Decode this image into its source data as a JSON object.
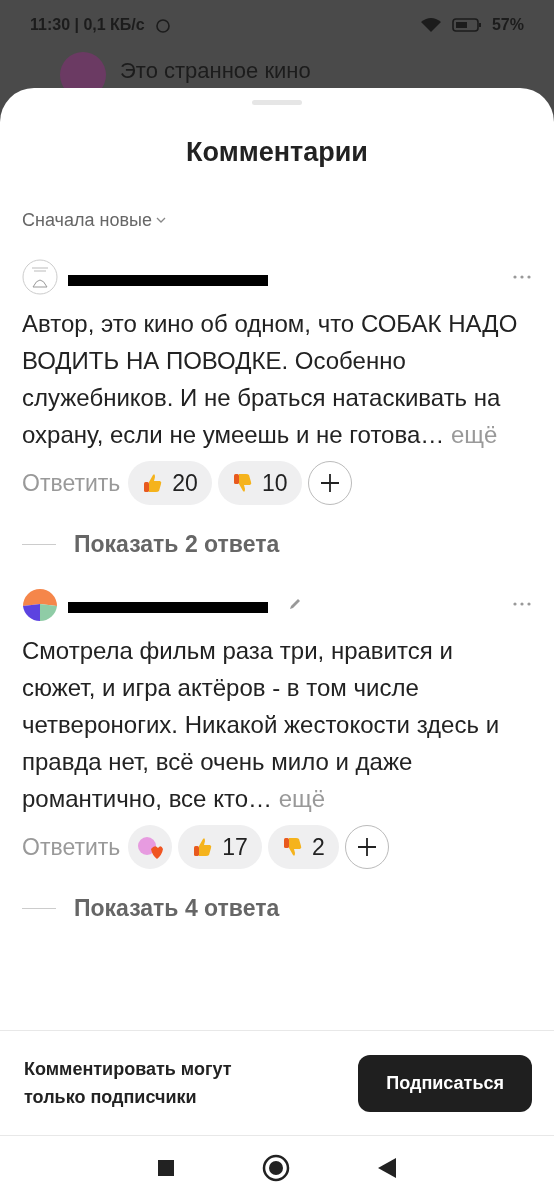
{
  "status_bar": {
    "time": "11:30 | 0,1 КБ/с",
    "battery": "57%"
  },
  "channel": {
    "title": "Это странное кино"
  },
  "sheet": {
    "title": "Комментарии",
    "sort": "Сначала новые"
  },
  "comments": [
    {
      "edited": false,
      "text": "Автор, это кино об одном, что СОБАК НАДО ВОДИТЬ НА ПОВОДКЕ. Особенно служебников. И не браться натаскивать на охрану, если не умеешь и не готова…",
      "more": "ещё",
      "reply": "Ответить",
      "sticker": false,
      "likes": "20",
      "dislikes": "10",
      "show_replies": "Показать 2 ответа"
    },
    {
      "edited": true,
      "text": "Смотрела фильм раза три, нравится и сюжет, и игра актёров - в том числе четвероногих. Никакой жестокости здесь и правда нет, всё очень мило и даже романтично, все кто…",
      "more": "ещё",
      "reply": "Ответить",
      "sticker": true,
      "likes": "17",
      "dislikes": "2",
      "show_replies": "Показать 4 ответа"
    }
  ],
  "footer": {
    "note": "Комментировать могут только подписчики",
    "button": "Подписаться"
  }
}
